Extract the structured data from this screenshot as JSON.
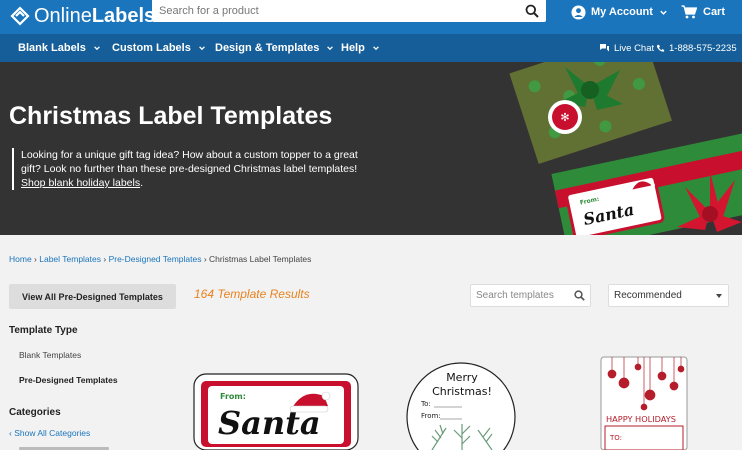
{
  "header": {
    "logo_prefix": "Online",
    "logo_bold": "Labels",
    "search_placeholder": "Search for a product",
    "account_label": "My Account",
    "cart_label": "Cart"
  },
  "nav": {
    "items": [
      {
        "label": "Blank Labels"
      },
      {
        "label": "Custom Labels"
      },
      {
        "label": "Design & Templates"
      },
      {
        "label": "Help"
      }
    ],
    "live_chat": "Live Chat",
    "phone": "1-888-575-2235"
  },
  "hero": {
    "title": "Christmas Label Templates",
    "text": "Looking for a unique gift tag idea? How about a custom topper to a great gift? Look no further than these pre-designed Christmas label templates! ",
    "link": "Shop blank holiday labels",
    "text_end": ".",
    "art_tag_from": "From:",
    "art_tag_name": "Santa"
  },
  "breadcrumb": {
    "items": [
      "Home",
      "Label Templates",
      "Pre-Designed Templates"
    ],
    "separator": " › ",
    "current": "Christmas Label Templates"
  },
  "toolbar": {
    "view_all": "View All Pre-Designed Templates",
    "results": "164 Template Results",
    "search_placeholder": "Search templates",
    "sort_value": "Recommended"
  },
  "sidebar": {
    "type_heading": "Template Type",
    "types": [
      "Blank Templates",
      "Pre-Designed Templates"
    ],
    "categories_heading": "Categories",
    "show_all": "Show All Categories"
  },
  "products": [
    {
      "from": "From:",
      "name": "Santa"
    },
    {
      "line1": "Merry",
      "line2": "Christmas!",
      "to": "To:",
      "from": "From:"
    },
    {
      "heading": "HAPPY HOLIDAYS",
      "to": "TO:"
    }
  ],
  "colors": {
    "brand_blue": "#1b75bc",
    "nav_blue": "#155e99",
    "hero_bg": "#333333",
    "results_orange": "#e8821e",
    "label_red": "#c8102e"
  }
}
